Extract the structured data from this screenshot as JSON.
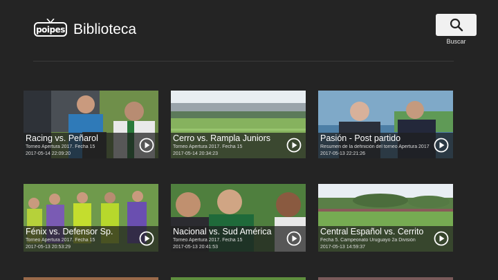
{
  "header": {
    "logo_text": "poipes",
    "title": "Biblioteca",
    "search_label": "Buscar",
    "search_icon": "search-icon"
  },
  "cards": [
    {
      "title": "Racing vs. Peñarol",
      "subtitle": "Torneo Apertura 2017. Fecha 15",
      "date": "2017-05-14 22:09:20"
    },
    {
      "title": "Cerro vs. Rampla Juniors",
      "subtitle": "Torneo Apertura 2017. Fecha 15",
      "date": "2017-05-14 20:34:23"
    },
    {
      "title": "Pasión - Post partido",
      "subtitle": "Resumen de la definición del torneo Apertura 2017",
      "date": "2017-05-13 22:21:26"
    },
    {
      "title": "Fénix vs. Defensor Sp.",
      "subtitle": "Torneo Apertura 2017. Fecha 15",
      "date": "2017-05-13 20:53:29"
    },
    {
      "title": "Nacional vs. Sud América",
      "subtitle": "Torneo Apertura 2017. Fecha 15",
      "date": "2017-05-13 20:41:53"
    },
    {
      "title": "Central Español vs. Cerrito",
      "subtitle": "Fecha 5. Campeonato Uruguayo 2a División",
      "date": "2017-05-13 14:59:37"
    }
  ],
  "colors": {
    "background": "#242424",
    "overlay": "#1e1e1e",
    "search_button": "#f1f1f1"
  }
}
